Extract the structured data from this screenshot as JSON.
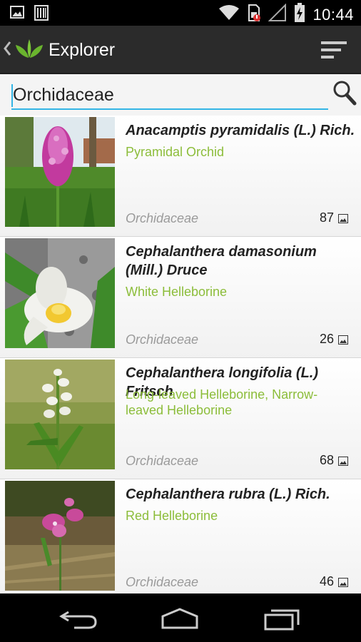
{
  "status_bar": {
    "time": "10:44",
    "icons": [
      "image-icon",
      "barcode-icon",
      "wifi-icon",
      "sim-alert-icon",
      "signal-icon",
      "battery-charging-icon"
    ]
  },
  "action_bar": {
    "title": "Explorer",
    "icons": [
      "back-chevron-icon",
      "leaf-logo-icon",
      "filter-sort-icon"
    ]
  },
  "search": {
    "value": "Orchidaceae",
    "icon": "search-icon",
    "accent_color": "#33b5e5"
  },
  "colors": {
    "common_name": "#8cbd3a",
    "family_name": "#9a9a9a",
    "action_bar_bg": "#2b2b2b"
  },
  "species": [
    {
      "scientific_name": "Anacamptis pyramidalis (L.) Rich.",
      "common_name": "Pyramidal Orchid",
      "family": "Orchidaceae",
      "photo_count": "87",
      "thumbnail": "pyramidal-orchid-photo"
    },
    {
      "scientific_name": "Cephalanthera damasonium (Mill.) Druce",
      "common_name": "White Helleborine",
      "family": "Orchidaceae",
      "photo_count": "26",
      "thumbnail": "white-helleborine-photo"
    },
    {
      "scientific_name": "Cephalanthera longifolia (L.) Fritsch",
      "common_name": "Long-leaved Helleborine, Narrow-leaved Helleborine",
      "family": "Orchidaceae",
      "photo_count": "68",
      "thumbnail": "long-leaved-helleborine-photo"
    },
    {
      "scientific_name": "Cephalanthera rubra (L.) Rich.",
      "common_name": "Red Helleborine",
      "family": "Orchidaceae",
      "photo_count": "46",
      "thumbnail": "red-helleborine-photo"
    }
  ],
  "nav_bar": {
    "icons": [
      "back-nav-icon",
      "home-nav-icon",
      "recents-nav-icon"
    ]
  }
}
